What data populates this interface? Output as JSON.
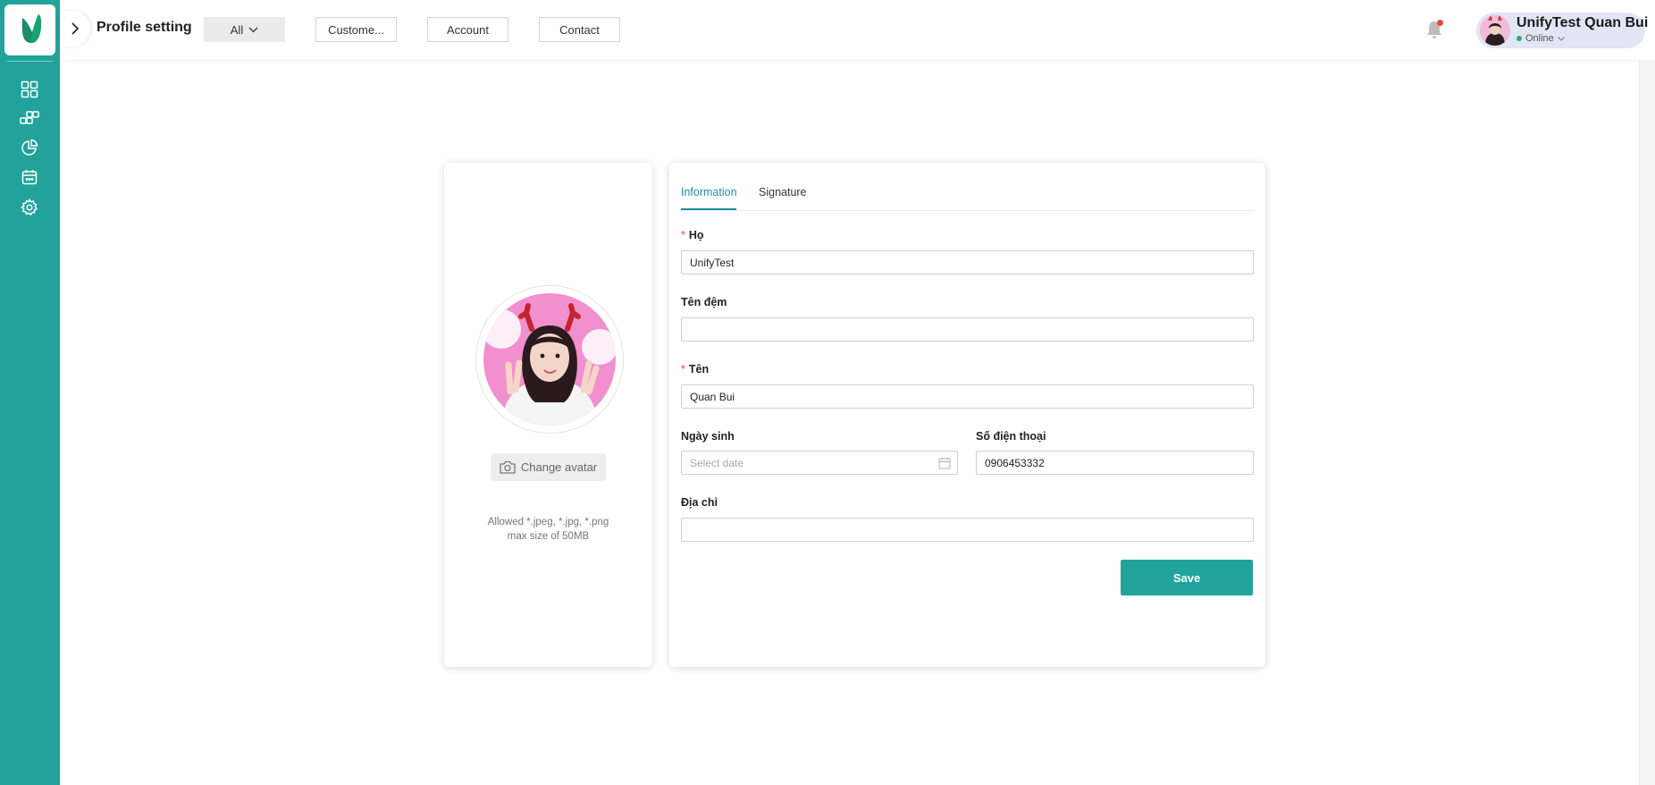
{
  "header": {
    "title": "Profile setting",
    "filters": [
      {
        "label": "All"
      },
      {
        "label": "Custome..."
      },
      {
        "label": "Account"
      },
      {
        "label": "Contact"
      }
    ]
  },
  "user": {
    "name": "UnifyTest Quan Bui",
    "status": "Online"
  },
  "sidebar": {
    "items": [
      "dashboard-icon",
      "apps-icon",
      "pie-chart-icon",
      "calendar-icon",
      "settings-icon"
    ]
  },
  "avatar_panel": {
    "change_label": "Change avatar",
    "hint_line1": "Allowed *.jpeg, *.jpg, *.png",
    "hint_line2": "max size of 50MB"
  },
  "tabs": [
    {
      "label": "Information",
      "active": true
    },
    {
      "label": "Signature",
      "active": false
    }
  ],
  "form": {
    "ho": {
      "label": "Họ",
      "value": "UnifyTest",
      "required": true
    },
    "ten_dem": {
      "label": "Tên đệm",
      "value": ""
    },
    "ten": {
      "label": "Tên",
      "value": "Quan Bui",
      "required": true
    },
    "ngay_sinh": {
      "label": "Ngày sinh",
      "value": "",
      "placeholder": "Select date"
    },
    "so_dien_thoai": {
      "label": "Số điện thoại",
      "value": "0906453332"
    },
    "dia_chi": {
      "label": "Địa chỉ",
      "value": ""
    },
    "save_label": "Save"
  },
  "colors": {
    "brand": "#21a39c",
    "tab_active": "#1a8fa0",
    "required": "#f5463b",
    "online": "#1fb36b"
  }
}
